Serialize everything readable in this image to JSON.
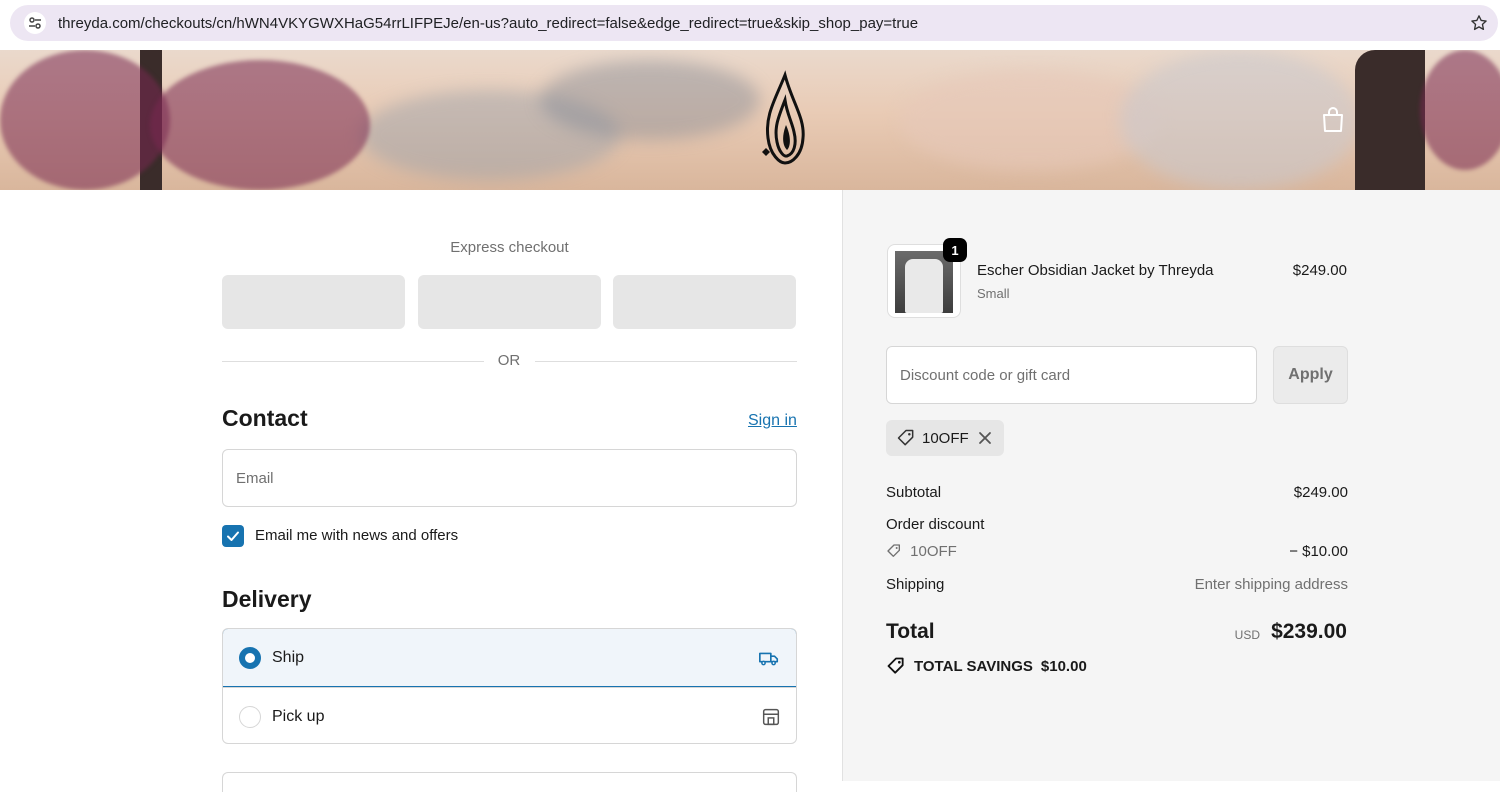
{
  "browser": {
    "url": "threyda.com/checkouts/cn/hWN4VKYGWXHaG54rrLIFPEJe/en-us?auto_redirect=false&edge_redirect=true&skip_shop_pay=true"
  },
  "express": {
    "label": "Express checkout",
    "or_label": "OR"
  },
  "contact": {
    "heading": "Contact",
    "sign_in": "Sign in",
    "email_placeholder": "Email",
    "news_label": "Email me with news and offers",
    "news_checked": true
  },
  "delivery": {
    "heading": "Delivery",
    "options": [
      {
        "label": "Ship",
        "selected": true,
        "icon": "truck-icon"
      },
      {
        "label": "Pick up",
        "selected": false,
        "icon": "store-icon"
      }
    ]
  },
  "cart": {
    "item": {
      "quantity": "1",
      "name": "Escher Obsidian Jacket by Threyda",
      "variant": "Small",
      "price": "$249.00"
    },
    "discount_placeholder": "Discount code or gift card",
    "apply_label": "Apply",
    "applied_code": "10OFF"
  },
  "summary": {
    "subtotal_label": "Subtotal",
    "subtotal_value": "$249.00",
    "discount_label": "Order discount",
    "discount_code": "10OFF",
    "discount_value": "− $10.00",
    "shipping_label": "Shipping",
    "shipping_value": "Enter shipping address",
    "total_label": "Total",
    "total_currency": "USD",
    "total_value": "$239.00",
    "savings_label": "TOTAL SAVINGS",
    "savings_value": "$10.00"
  },
  "colors": {
    "accent": "#1773b0",
    "chip_bg": "#e6e6e6",
    "summary_bg": "#f5f5f5"
  }
}
